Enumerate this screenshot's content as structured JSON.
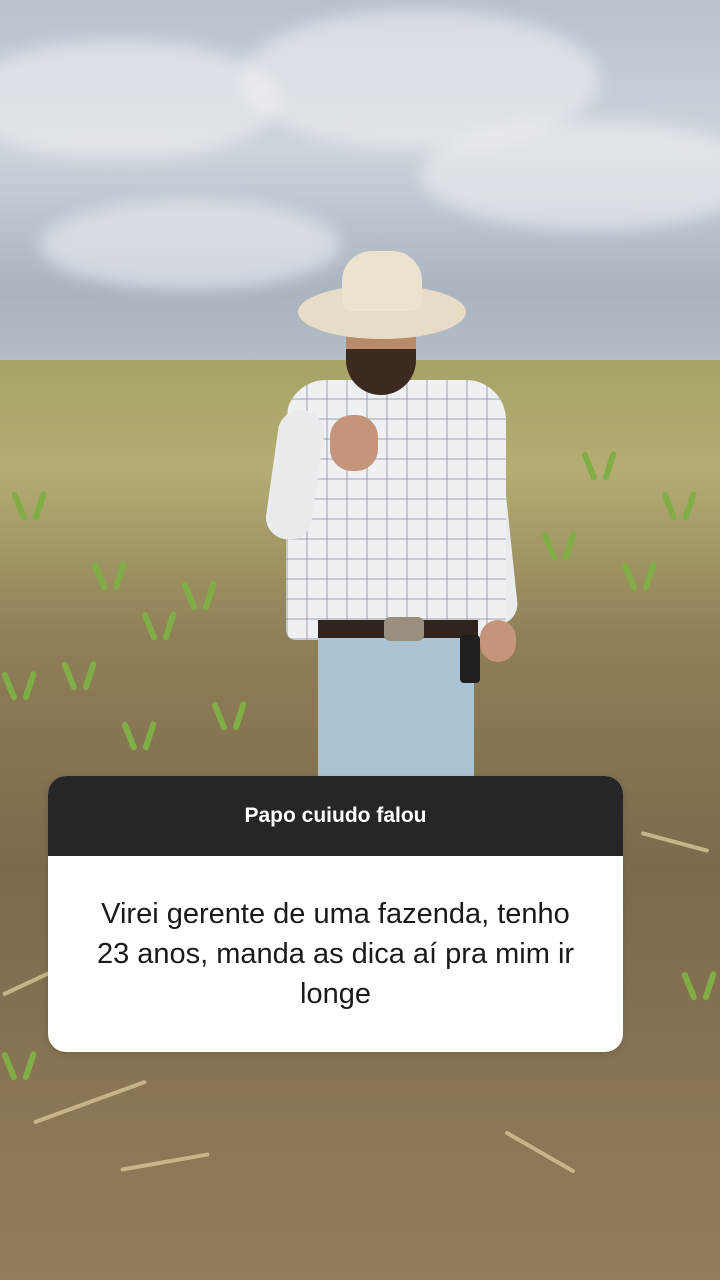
{
  "question_sticker": {
    "header": "Papo cuiudo falou",
    "question": "Virei gerente de uma fazenda, tenho 23 anos, manda as dica aí pra mim ir longe"
  },
  "colors": {
    "sticker_header_bg": "#262626",
    "sticker_body_bg": "#ffffff"
  }
}
